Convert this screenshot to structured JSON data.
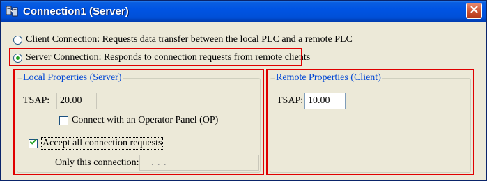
{
  "window": {
    "title": "Connection1 (Server)",
    "title_icon": "plc-connection-icon",
    "close_icon": "close-icon"
  },
  "connection_type": {
    "client_label": "Client Connection: Requests data transfer between the local PLC and a remote PLC",
    "server_label": "Server Connection: Responds to connection requests from remote clients",
    "selected": "server"
  },
  "local": {
    "legend": "Local Properties (Server)",
    "tsap_label": "TSAP:",
    "tsap_value": "20.00",
    "op_label": "Connect with an Operator Panel (OP)",
    "op_checked": false,
    "accept_label": "Accept all connection requests",
    "accept_checked": true,
    "only_label": "Only this connection:",
    "only_value": ".   .   ."
  },
  "remote": {
    "legend": "Remote Properties (Client)",
    "tsap_label": "TSAP:",
    "tsap_value": "10.00"
  },
  "colors": {
    "highlight_box": "#e00000",
    "group_legend": "#0046d5",
    "title_bar": "#0054e3"
  }
}
